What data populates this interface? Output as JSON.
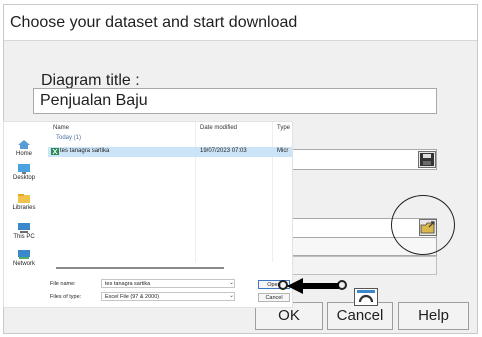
{
  "dialog": {
    "title": "Choose your dataset and start download",
    "diagram_title_label": "Diagram title :",
    "diagram_title_value": "Penjualan Baju",
    "buttons": {
      "ok": "OK",
      "cancel": "Cancel",
      "help": "Help"
    }
  },
  "file_dialog": {
    "nav": [
      "Home",
      "Desktop",
      "Libraries",
      "This PC",
      "Network"
    ],
    "columns": {
      "name": "Name",
      "date": "Date modified",
      "type": "Type"
    },
    "group": "Today (1)",
    "file": {
      "name": "tes tanagra sartika",
      "date": "19/07/2023 07:03",
      "type": "Micr"
    },
    "file_name_label": "File name:",
    "file_name_value": "tes tanagra sartika",
    "file_type_label": "Files of type:",
    "file_type_value": "Excel File (97 & 2000)",
    "open_button": "Open",
    "cancel_button": "Cancel"
  },
  "colors": {
    "selection": "#cce4f7",
    "accent": "#3b78c8"
  },
  "icons": [
    "floppy-save-icon",
    "folder-browse-icon",
    "home-icon",
    "desktop-icon",
    "libraries-icon",
    "this-pc-icon",
    "network-icon",
    "excel-file-icon",
    "arrow-left-icon"
  ]
}
